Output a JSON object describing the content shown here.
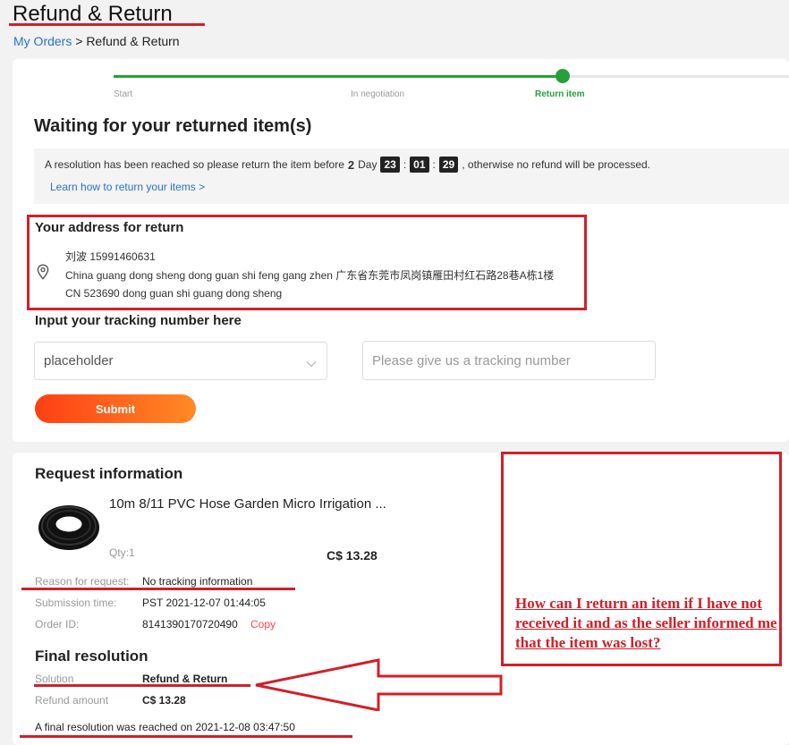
{
  "page": {
    "title": "Refund & Return"
  },
  "breadcrumb": {
    "parent": "My Orders",
    "separator": " > ",
    "current": "Refund & Return"
  },
  "progress": {
    "steps": [
      "Start",
      "In negotiation",
      "Return item"
    ],
    "active_step": "Return item",
    "colors": {
      "active": "#25a03a",
      "inactive": "#e6e6e6"
    }
  },
  "waiting": {
    "heading": "Waiting for your returned item(s)",
    "notice_before": "A resolution has been reached so please return the item before",
    "days": "2",
    "day_label": "Day",
    "hours": "23",
    "minutes": "01",
    "seconds": "29",
    "colon": ":",
    "notice_after": ", otherwise no refund will be processed.",
    "learn_link": "Learn how to return your items >"
  },
  "address": {
    "heading": "Your address for return",
    "icon": "location-pin-icon",
    "name_phone": "刘波 15991460631",
    "line1": "China guang dong sheng dong guan shi feng gang zhen 广东省东莞市凤岗镇雁田村红石路28巷A栋1楼",
    "line2": "CN 523690 dong guan shi guang dong sheng"
  },
  "tracking": {
    "heading": "Input your tracking number here",
    "carrier_value": "placeholder",
    "tracking_placeholder": "Please give us a tracking number",
    "submit_label": "Submit"
  },
  "request": {
    "heading": "Request information",
    "product_title": "10m 8/11 PVC Hose Garden Micro Irrigation ...",
    "qty": "Qty:1",
    "price": "C$ 13.28",
    "reason_label": "Reason for request:",
    "reason_value": "No tracking information",
    "submission_label": "Submission time:",
    "submission_value": "PST 2021-12-07 01:44:05",
    "order_label": "Order ID:",
    "order_value": "8141390170720490",
    "copy_label": "Copy"
  },
  "final": {
    "heading": "Final resolution",
    "solution_label": "Solution",
    "solution_value": "Refund & Return",
    "refund_label": "Refund amount",
    "refund_value": "C$ 13.28",
    "footer": "A final resolution was reached on 2021-12-08 03:47:50"
  },
  "callout": {
    "text": "How can I return an item if I have not received it and as the seller informed me that the item was lost?"
  },
  "colors": {
    "annotation_red": "#d0202a",
    "link_blue": "#2a72c6",
    "accent_orange": "#ff4747"
  }
}
